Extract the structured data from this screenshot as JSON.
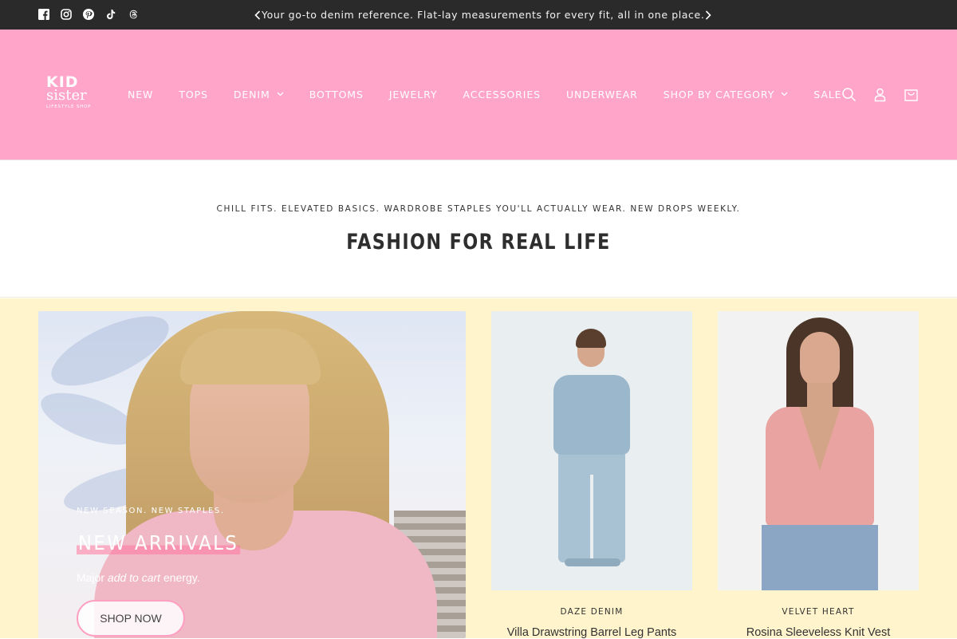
{
  "topbar": {
    "social_icons": [
      "facebook-icon",
      "instagram-icon",
      "pinterest-icon",
      "tiktok-icon",
      "threads-icon"
    ],
    "announcement": "Your go-to denim reference. Flat-lay measurements for every fit, all in one place."
  },
  "header": {
    "background": "#ffa5c9",
    "logo": {
      "line1": "KID",
      "line2": "sister",
      "line3": "LIFESTYLE SHOP"
    },
    "nav": [
      {
        "label": "NEW"
      },
      {
        "label": "TOPS"
      },
      {
        "label": "DENIM",
        "dropdown": true
      },
      {
        "label": "BOTTOMS"
      },
      {
        "label": "JEWELRY"
      },
      {
        "label": "ACCESSORIES"
      },
      {
        "label": "UNDERWEAR"
      },
      {
        "label": "SHOP BY CATEGORY",
        "dropdown": true
      },
      {
        "label": "SALE"
      }
    ],
    "icons": [
      "search-icon",
      "account-icon",
      "cart-icon"
    ]
  },
  "intro": {
    "subtitle": "CHILL FITS. ELEVATED BASICS. WARDROBE STAPLES YOU'LL ACTUALLY WEAR. NEW DROPS WEEKLY.",
    "title": "FASHION FOR REAL LIFE"
  },
  "hero": {
    "kicker": "NEW SEASON. NEW STAPLES.",
    "title": "NEW ARRIVALS",
    "tagline_pre": "Major ",
    "tagline_em": "add to cart",
    "tagline_post": " energy.",
    "button": "SHOP NOW"
  },
  "products": [
    {
      "brand": "DAZE DENIM",
      "title": "Villa Drawstring Barrel Leg Pants"
    },
    {
      "brand": "VELVET HEART",
      "title": "Rosina Sleeveless Knit Vest"
    }
  ],
  "colors": {
    "topbar": "#2a2a2a",
    "section_bg": "#fff4cc",
    "accent_pink": "#ff9fc2"
  }
}
